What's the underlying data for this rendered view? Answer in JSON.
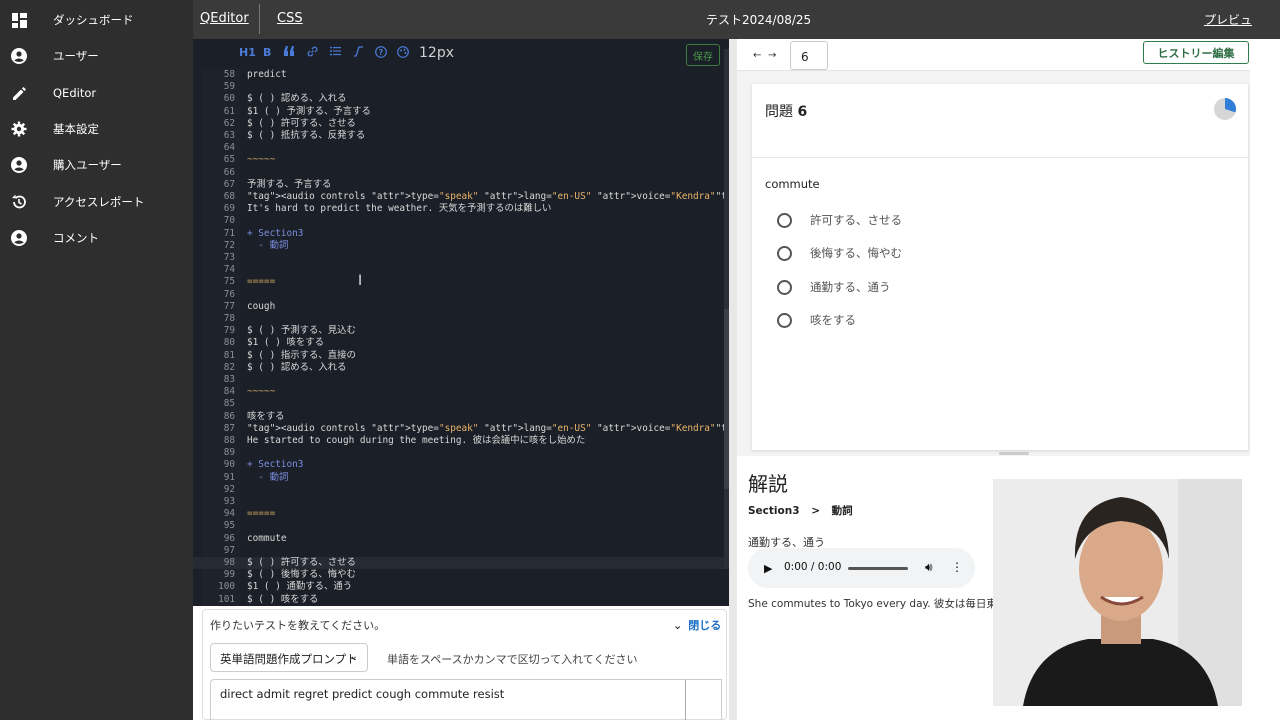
{
  "sidebar": {
    "items": [
      {
        "label": "ダッシュボード",
        "icon": "dashboard-icon"
      },
      {
        "label": "ユーザー",
        "icon": "account-circle-icon"
      },
      {
        "label": "QEditor",
        "icon": "pencil-icon"
      },
      {
        "label": "基本設定",
        "icon": "gear-icon"
      },
      {
        "label": "購入ユーザー",
        "icon": "account-circle-icon"
      },
      {
        "label": "アクセスレポート",
        "icon": "history-icon"
      },
      {
        "label": "コメント",
        "icon": "account-circle-icon"
      }
    ]
  },
  "topbar": {
    "tab_editor": "QEditor",
    "tab_css": "CSS",
    "title": "テスト2024/08/25",
    "preview_label": "プレビュ"
  },
  "editor": {
    "toolbar": {
      "h1": "H1",
      "bold": "B",
      "font_size": "12px",
      "save": "保存"
    },
    "lines": [
      {
        "n": "58",
        "t": "predict"
      },
      {
        "n": "59",
        "t": ""
      },
      {
        "n": "60",
        "t": "$ ( ) 認める、入れる"
      },
      {
        "n": "61",
        "t": "$1 ( ) 予測する、予言する"
      },
      {
        "n": "62",
        "t": "$ ( ) 許可する、させる"
      },
      {
        "n": "63",
        "t": "$ ( ) 抵抗する、反発する"
      },
      {
        "n": "64",
        "t": ""
      },
      {
        "n": "65",
        "t": "~~~~~"
      },
      {
        "n": "66",
        "t": ""
      },
      {
        "n": "67",
        "t": "予測する、予言する"
      },
      {
        "n": "68",
        "t": "<audio controls type=\"speak\" lang=\"en-US\" voice=\"Kendra\">predict</audio>"
      },
      {
        "n": "69",
        "t": "It's hard to predict the weather. 天気を予測するのは難しい"
      },
      {
        "n": "70",
        "t": ""
      },
      {
        "n": "71",
        "t": "+ Section3"
      },
      {
        "n": "72",
        "t": "  - 動詞"
      },
      {
        "n": "73",
        "t": ""
      },
      {
        "n": "74",
        "t": ""
      },
      {
        "n": "75",
        "t": "====="
      },
      {
        "n": "76",
        "t": ""
      },
      {
        "n": "77",
        "t": "cough"
      },
      {
        "n": "78",
        "t": ""
      },
      {
        "n": "79",
        "t": "$ ( ) 予測する、見込む"
      },
      {
        "n": "80",
        "t": "$1 ( ) 咳をする"
      },
      {
        "n": "81",
        "t": "$ ( ) 指示する、直接の"
      },
      {
        "n": "82",
        "t": "$ ( ) 認める、入れる"
      },
      {
        "n": "83",
        "t": ""
      },
      {
        "n": "84",
        "t": "~~~~~"
      },
      {
        "n": "85",
        "t": ""
      },
      {
        "n": "86",
        "t": "咳をする"
      },
      {
        "n": "87",
        "t": "<audio controls type=\"speak\" lang=\"en-US\" voice=\"Kendra\">cough</audio>"
      },
      {
        "n": "88",
        "t": "He started to cough during the meeting. 彼は会議中に咳をし始めた"
      },
      {
        "n": "89",
        "t": ""
      },
      {
        "n": "90",
        "t": "+ Section3"
      },
      {
        "n": "91",
        "t": "  - 動詞"
      },
      {
        "n": "92",
        "t": ""
      },
      {
        "n": "93",
        "t": ""
      },
      {
        "n": "94",
        "t": "====="
      },
      {
        "n": "95",
        "t": ""
      },
      {
        "n": "96",
        "t": "commute"
      },
      {
        "n": "97",
        "t": ""
      },
      {
        "n": "98",
        "t": "$ ( ) 許可する、させる"
      },
      {
        "n": "99",
        "t": "$ ( ) 後悔する、悔やむ"
      },
      {
        "n": "100",
        "t": "$1 ( ) 通勤する、通う"
      },
      {
        "n": "101",
        "t": "$ ( ) 咳をする"
      }
    ]
  },
  "prompt": {
    "label": "作りたいテストを教えてください。",
    "close": "閉じる",
    "select_value": "英単語問題作成プロンプト",
    "hint": "単語をスペースかカンマで区切って入れてください",
    "input_value": "direct admit regret predict cough commute resist"
  },
  "preview": {
    "page": "6",
    "history_button": "ヒストリー編集",
    "question_title_prefix": "問題",
    "question_number": "6",
    "word": "commute",
    "options": [
      "許可する、させる",
      "後悔する、悔やむ",
      "通勤する、通う",
      "咳をする"
    ],
    "progress": 0.3
  },
  "explanation": {
    "heading": "解説",
    "crumb_section": "Section3",
    "crumb_sep": ">",
    "crumb_pos": "動詞",
    "meaning": "通勤する、通う",
    "audio_time": "0:00 / 0:00",
    "sentence": "She commutes to Tokyo every day. 彼女は毎日東京に"
  },
  "colors": {
    "sidebar_bg": "#2e2e2e",
    "topbar_bg": "#3a3a3a",
    "editor_bg": "#1b1f27",
    "accent_green": "#2f7d4f",
    "pie_blue": "#2f7fd8"
  }
}
